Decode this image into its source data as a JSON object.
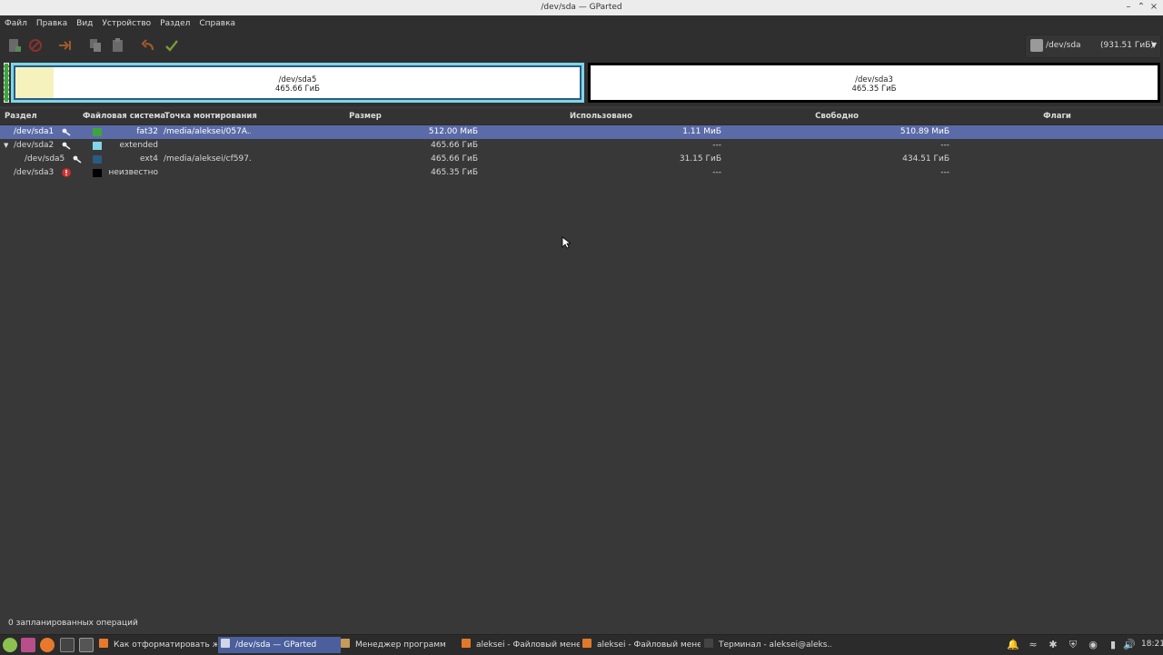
{
  "window": {
    "title": "/dev/sda — GParted"
  },
  "menubar": {
    "items": [
      "Файл",
      "Правка",
      "Вид",
      "Устройство",
      "Раздел",
      "Справка"
    ]
  },
  "toolbar": {
    "icons": [
      "new-icon",
      "delete-icon",
      "resize-move-icon",
      "copy-icon",
      "paste-icon",
      "undo-icon",
      "apply-icon"
    ]
  },
  "device": {
    "name": "/dev/sda",
    "size": "(931.51 ГиБ)"
  },
  "graphic": {
    "sda5": {
      "name": "/dev/sda5",
      "size": "465.66 ГиБ",
      "used_fraction": 0.067
    },
    "sda3": {
      "name": "/dev/sda3",
      "size": "465.35 ГиБ"
    }
  },
  "table": {
    "headers": {
      "partition": "Раздел",
      "filesystem": "Файловая система",
      "mountpoint": "Точка монтирования",
      "size": "Размер",
      "used": "Использовано",
      "free": "Свободно",
      "flags": "Флаги"
    },
    "rows": [
      {
        "partition": "/dev/sda1",
        "fs": "fat32",
        "fs_color": "#3fa43f",
        "mount": "/media/aleksei/057A...",
        "size": "512.00 МиБ",
        "used": "1.11 МиБ",
        "free": "510.89 МиБ",
        "flags": "",
        "icon": "key-icon"
      },
      {
        "partition": "/dev/sda2",
        "fs": "extended",
        "fs_color": "#7fd6e6",
        "mount": "",
        "size": "465.66 ГиБ",
        "used": "---",
        "free": "---",
        "flags": "",
        "icon": "key-icon"
      },
      {
        "partition": "/dev/sda5",
        "fs": "ext4",
        "fs_color": "#2a5a86",
        "mount": "/media/aleksei/cf597...",
        "size": "465.66 ГиБ",
        "used": "31.15 ГиБ",
        "free": "434.51 ГиБ",
        "flags": "",
        "icon": "key-icon"
      },
      {
        "partition": "/dev/sda3",
        "fs": "неизвестно",
        "fs_color": "#000000",
        "mount": "",
        "size": "465.35 ГиБ",
        "used": "---",
        "free": "---",
        "flags": "",
        "icon": "warning-icon"
      }
    ]
  },
  "status": {
    "text": "0 запланированных операций"
  },
  "taskbar": {
    "tasks": [
      {
        "label": "Как отформатировать ж...",
        "color": "#e8792c"
      },
      {
        "label": "/dev/sda — GParted",
        "color": "#cfd6e6"
      },
      {
        "label": "Менеджер программ",
        "color": "#c89a5a"
      },
      {
        "label": "aleksei - Файловый мене...",
        "color": "#e07a2a"
      },
      {
        "label": "aleksei - Файловый мене...",
        "color": "#e07a2a"
      },
      {
        "label": "Терминал - aleksei@aleks...",
        "color": "#444444"
      }
    ],
    "clock": "18:21"
  }
}
